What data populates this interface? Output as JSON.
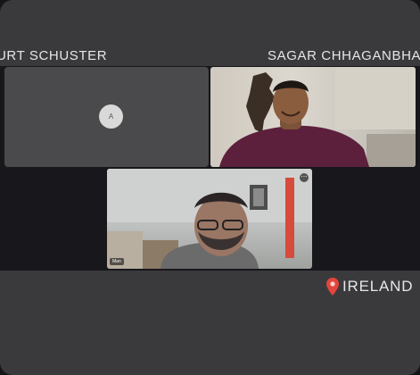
{
  "participants": [
    {
      "name": "URT SCHUSTER",
      "avatar_initial": "A"
    },
    {
      "name": "SAGAR  CHHAGANBHA"
    }
  ],
  "bottom_tile": {
    "name_tag": "Man"
  },
  "location": {
    "label": "IRELAND",
    "pin_color": "#e2453c"
  },
  "colors": {
    "background": "#3a3a3c",
    "stage": "#17171c",
    "text": "#e6e6e6"
  }
}
